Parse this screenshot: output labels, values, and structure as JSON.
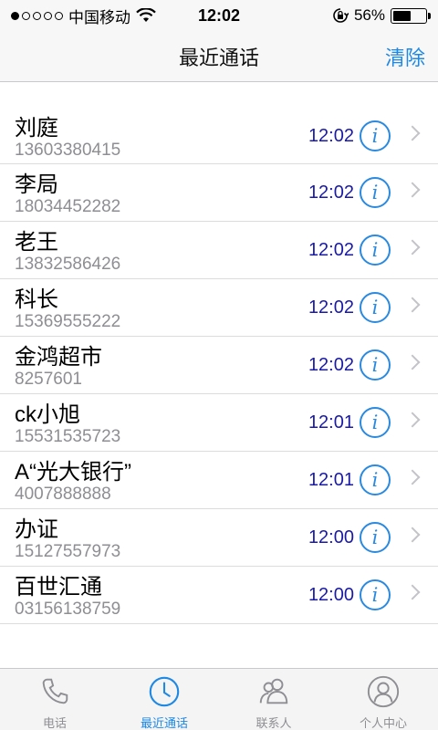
{
  "status_bar": {
    "carrier": "中国移动",
    "time": "12:02",
    "battery_percent": "56%",
    "battery_level": 0.56,
    "signal_bars": 1,
    "signal_total": 5
  },
  "nav": {
    "title": "最近通话",
    "clear_label": "清除"
  },
  "calls": [
    {
      "name": "刘庭",
      "number": "13603380415",
      "time": "12:02"
    },
    {
      "name": "李局",
      "number": "18034452282",
      "time": "12:02"
    },
    {
      "name": "老王",
      "number": "13832586426",
      "time": "12:02"
    },
    {
      "name": "科长",
      "number": "15369555222",
      "time": "12:02"
    },
    {
      "name": "金鸿超市",
      "number": "8257601",
      "time": "12:02"
    },
    {
      "name": "ck小旭",
      "number": "15531535723",
      "time": "12:01"
    },
    {
      "name": "A“光大银行”",
      "number": "4007888888",
      "time": "12:01"
    },
    {
      "name": "办证",
      "number": "15127557973",
      "time": "12:00"
    },
    {
      "name": "百世汇通",
      "number": "03156138759",
      "time": "12:00"
    }
  ],
  "info_glyph": "i",
  "tabs": [
    {
      "label": "电话",
      "icon": "phone-icon",
      "active": false
    },
    {
      "label": "最近通话",
      "icon": "clock-icon",
      "active": true
    },
    {
      "label": "联系人",
      "icon": "contacts-icon",
      "active": false
    },
    {
      "label": "个人中心",
      "icon": "profile-icon",
      "active": false
    }
  ],
  "colors": {
    "accent": "#1e88e5",
    "time_text": "#1a1aa6",
    "secondary_text": "#8e8e93"
  }
}
